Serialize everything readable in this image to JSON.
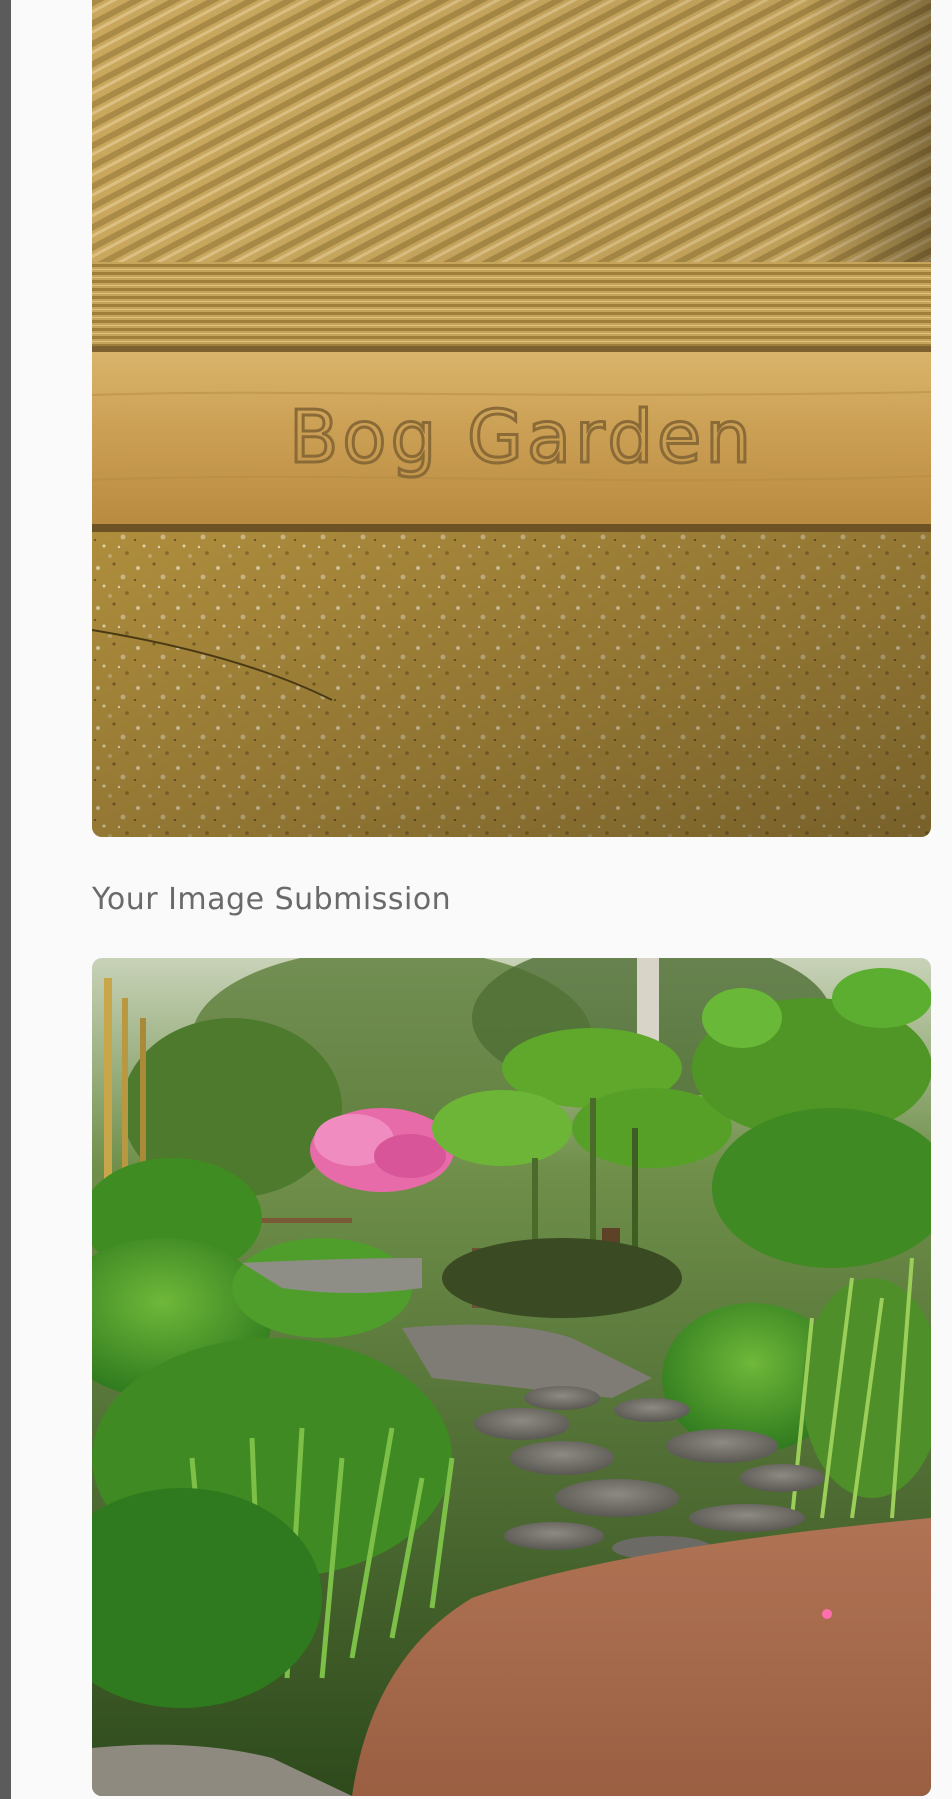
{
  "page": {
    "background": "#fafafa",
    "rail_color": "#5b5b5b"
  },
  "reference_image": {
    "engraved_text": "Bog Garden",
    "alt": "Wooden sleeper engraved with Bog Garden above a gravel path"
  },
  "submission": {
    "heading": "Your Image Submission",
    "heading_color": "#6a6a6a",
    "alt": "Garden path with stepping stones, giant leafy plants and a pink azalea"
  }
}
